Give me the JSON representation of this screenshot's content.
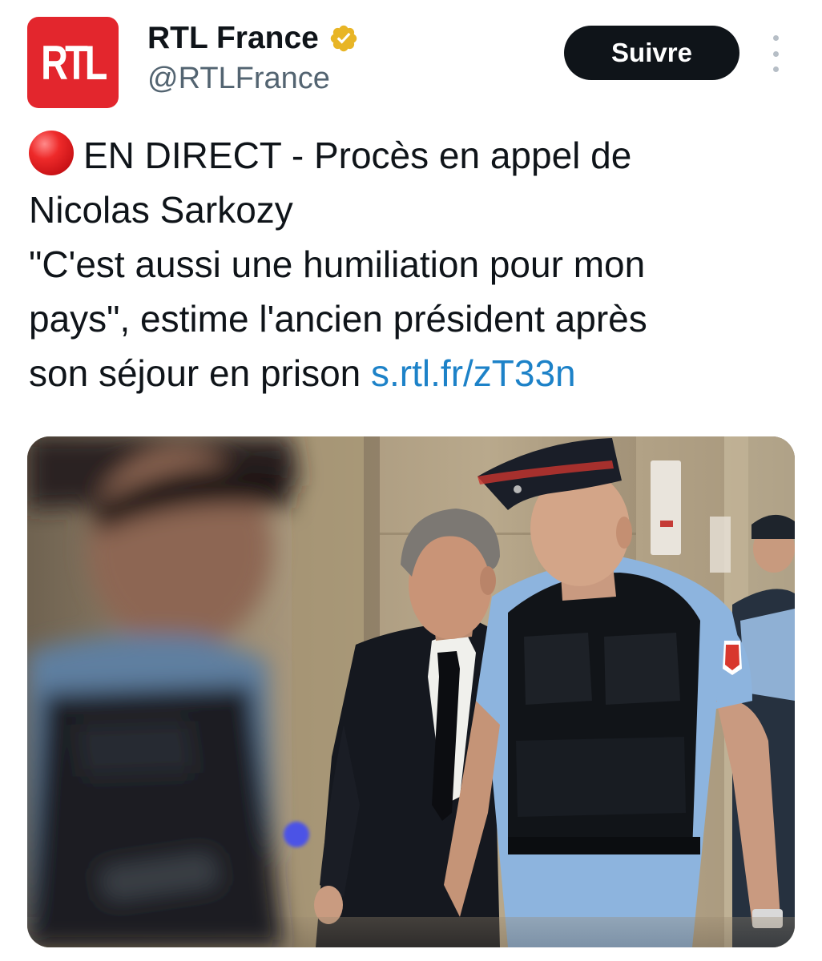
{
  "account": {
    "avatar_text": "RTL",
    "display_name": "RTL France",
    "handle": "@RTLFrance",
    "verified_icon": "verified-badge-icon",
    "verified_color": "#e8b526",
    "avatar_color": "#e3262d"
  },
  "actions": {
    "follow_label": "Suivre",
    "more_icon": "more-vertical-icon"
  },
  "tweet": {
    "live_icon": "red-circle-icon",
    "line1": "EN DIRECT - Procès en appel de",
    "line2": "Nicolas Sarkozy",
    "line3": "\"C'est aussi une humiliation pour mon",
    "line4": "pays\", estime l'ancien président après",
    "line5_text": "son séjour en prison ",
    "link": "s.rtl.fr/zT33n",
    "link_color": "#1d82c8"
  },
  "media": {
    "type": "photo"
  }
}
